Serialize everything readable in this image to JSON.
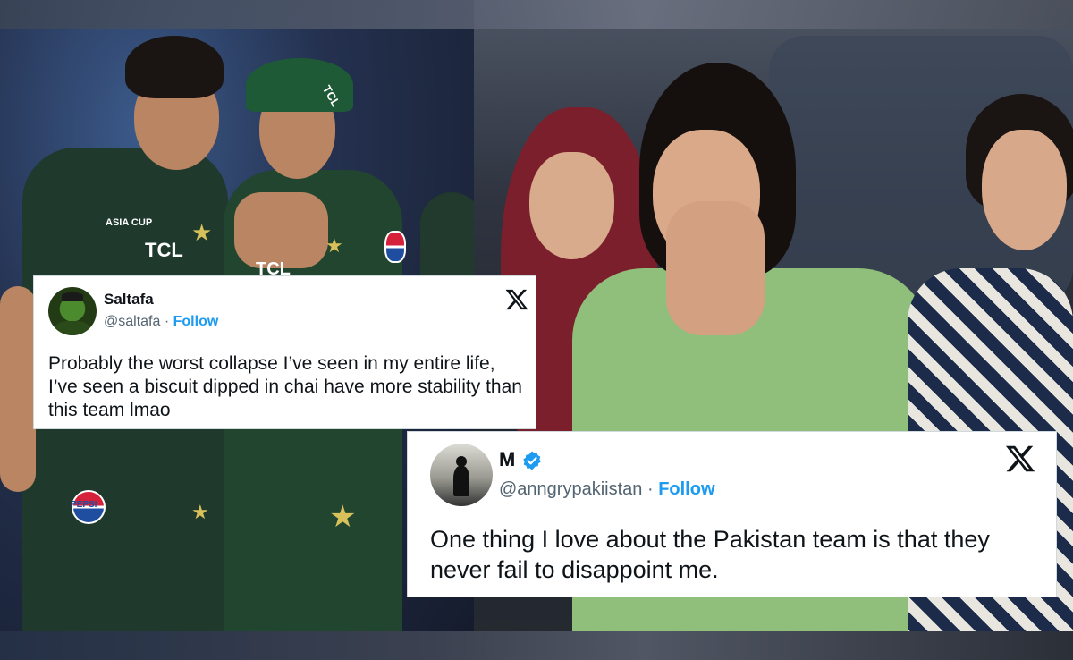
{
  "tweets": [
    {
      "author_name": "Saltafa",
      "handle": "@saltafa",
      "separator": "·",
      "follow_label": "Follow",
      "verified": false,
      "text": "Probably the worst collapse I’ve seen in my entire life, I’ve seen a biscuit dipped in chai have more stability than this team lmao",
      "platform_icon": "x-logo-icon"
    },
    {
      "author_name": "M",
      "handle": "@anngrypakiistan",
      "separator": "·",
      "follow_label": "Follow",
      "verified": true,
      "text": "One thing I love about the Pakistan team is that they never fail to disappoint me.",
      "platform_icon": "x-logo-icon"
    }
  ],
  "photo_left": {
    "jersey_texts": [
      "TCL",
      "TCL",
      "TCL",
      "ASIA CUP"
    ],
    "sponsor_badge": "PEPSI"
  },
  "colors": {
    "follow": "#1d9bf0",
    "verified_badge": "#1d9bf0",
    "card_bg": "#ffffff",
    "text": "#0f1419",
    "muted": "#536471"
  }
}
